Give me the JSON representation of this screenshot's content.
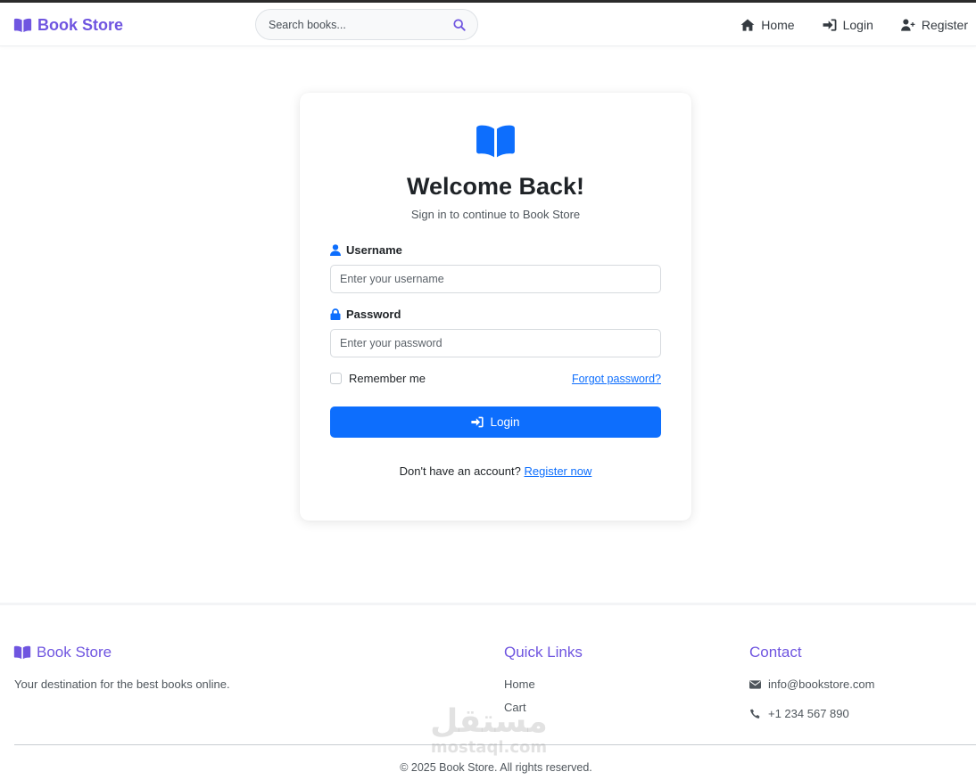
{
  "colors": {
    "brand": "#6f55e0",
    "primary": "#0d6efd",
    "text": "#212529",
    "muted": "#4f565c"
  },
  "navbar": {
    "brand_label": "Book Store",
    "brand_icon": "book-open-icon",
    "search": {
      "placeholder": "Search books...",
      "icon": "search-icon"
    },
    "links": [
      {
        "label": "Home",
        "icon": "home-icon"
      },
      {
        "label": "Login",
        "icon": "sign-in-icon"
      },
      {
        "label": "Register",
        "icon": "user-plus-icon"
      }
    ]
  },
  "login_card": {
    "icon": "book-open-icon",
    "title": "Welcome Back!",
    "subtitle": "Sign in to continue to Book Store",
    "username": {
      "label": "Username",
      "placeholder": "Enter your username",
      "icon": "user-icon"
    },
    "password": {
      "label": "Password",
      "placeholder": "Enter your password",
      "icon": "lock-icon"
    },
    "remember_label": "Remember me",
    "forgot_label": "Forgot password?",
    "submit_label": "Login",
    "register_prompt": "Don't have an account?",
    "register_link": "Register now"
  },
  "footer": {
    "brand_label": "Book Store",
    "description": "Your destination for the best books online.",
    "quick_links_heading": "Quick Links",
    "quick_links": [
      "Home",
      "Cart"
    ],
    "contact_heading": "Contact",
    "email": "info@bookstore.com",
    "phone": "+1 234 567 890",
    "copyright": "© 2025 Book Store. All rights reserved."
  },
  "watermark": {
    "arabic": "مستقل",
    "latin": "mostaql.com"
  }
}
